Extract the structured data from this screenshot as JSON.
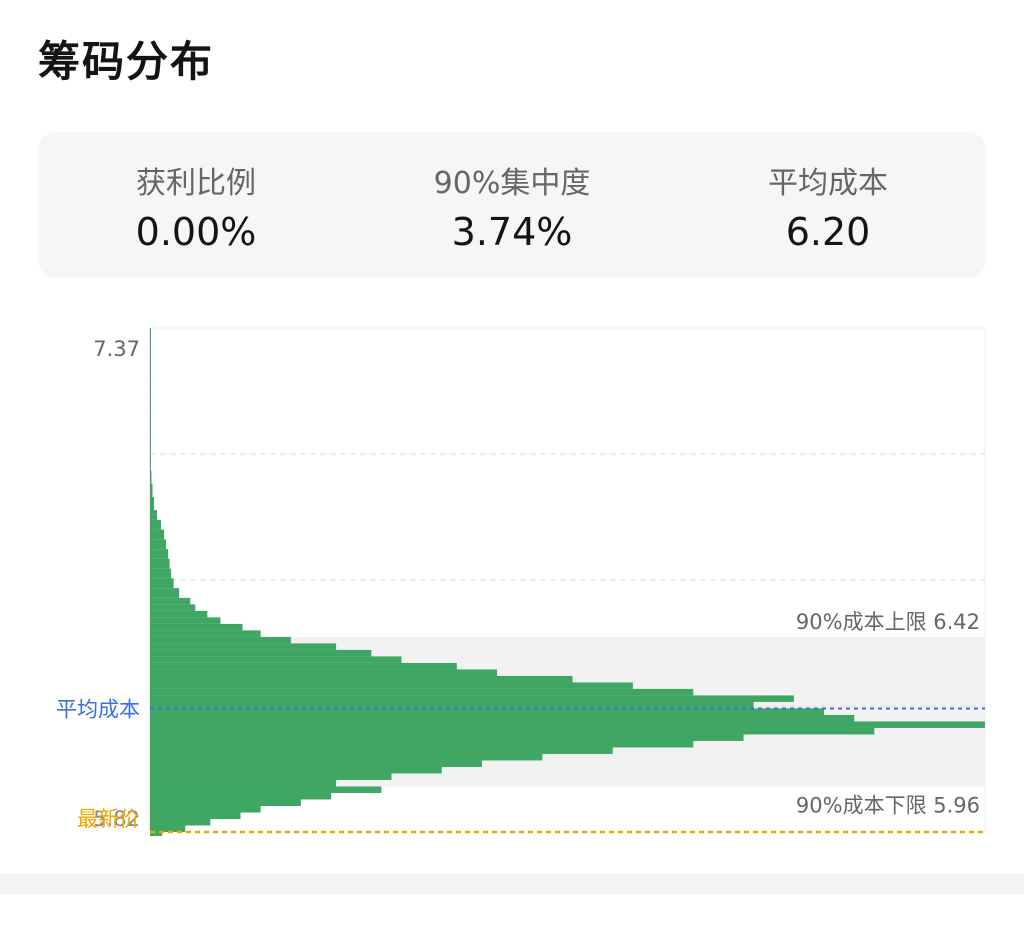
{
  "header": {
    "title": "筹码分布"
  },
  "stats": [
    {
      "label": "获利比例",
      "value": "0.00%"
    },
    {
      "label": "90%集中度",
      "value": "3.74%"
    },
    {
      "label": "平均成本",
      "value": "6.20"
    }
  ],
  "chart_data": {
    "type": "bar",
    "orientation": "horizontal",
    "price_max_label": "7.37",
    "price_min_label": "5.82",
    "latest_label": "最新价",
    "price_range": [
      5.82,
      7.37
    ],
    "avg_cost": {
      "label": "平均成本",
      "value": 6.2
    },
    "upper_band": {
      "label": "90%成本上限 6.42",
      "value": 6.42
    },
    "lower_band": {
      "label": "90%成本下限 5.96",
      "value": 5.96
    },
    "latest_price": 5.82,
    "grid": true,
    "colors": {
      "bars": "#3fa663",
      "avg_line": "#3b6fe0",
      "latest_line": "#f0a800",
      "band_fill": "#f2f2f2",
      "grid": "#dddddd"
    },
    "distribution": {
      "price": [
        7.37,
        7.32,
        7.28,
        7.22,
        7.17,
        7.1,
        7.04,
        6.98,
        6.93,
        6.89,
        6.85,
        6.81,
        6.78,
        6.75,
        6.72,
        6.69,
        6.66,
        6.63,
        6.6,
        6.57,
        6.54,
        6.52,
        6.5,
        6.48,
        6.46,
        6.44,
        6.42,
        6.4,
        6.38,
        6.36,
        6.34,
        6.32,
        6.3,
        6.28,
        6.26,
        6.24,
        6.22,
        6.2,
        6.18,
        6.16,
        6.14,
        6.12,
        6.1,
        6.08,
        6.06,
        6.04,
        6.02,
        6.0,
        5.98,
        5.96,
        5.94,
        5.92,
        5.9,
        5.88,
        5.86,
        5.84,
        5.82
      ],
      "volume": [
        0.5,
        0.5,
        0.6,
        0.6,
        0.7,
        0.8,
        0.9,
        1.0,
        1.5,
        2.5,
        4.0,
        7.0,
        11.0,
        14.0,
        16.0,
        18.0,
        19.5,
        21.0,
        23.5,
        29.0,
        40.0,
        45.0,
        57.0,
        70.0,
        92.0,
        110.0,
        140.0,
        185.0,
        220.0,
        250.0,
        305.0,
        345.0,
        420.0,
        480.0,
        540.0,
        640.0,
        600.0,
        670.0,
        700.0,
        830.0,
        720.0,
        590.0,
        540.0,
        460.0,
        390.0,
        330.0,
        290.0,
        240.0,
        185.0,
        230.0,
        180.0,
        150.0,
        110.0,
        90.0,
        60.0,
        35.0,
        12.0
      ]
    }
  }
}
